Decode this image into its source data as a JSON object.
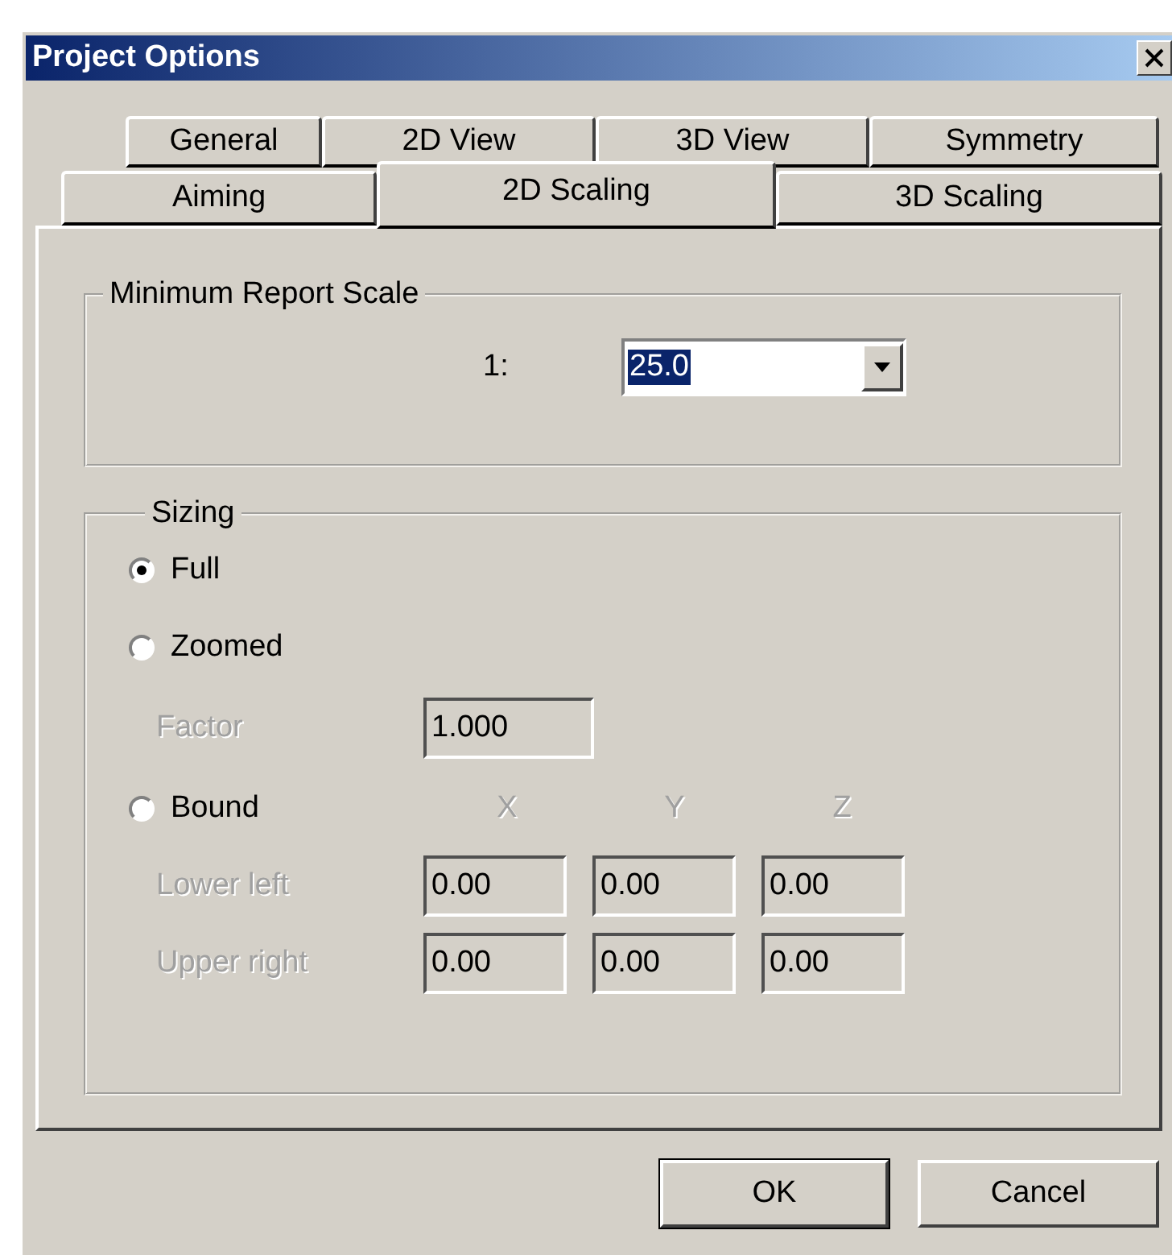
{
  "window": {
    "title": "Project Options"
  },
  "tab_rows": [
    {
      "tabs": [
        {
          "label": "General",
          "selected": false
        },
        {
          "label": "2D View",
          "selected": false
        },
        {
          "label": "3D View",
          "selected": false
        },
        {
          "label": "Symmetry",
          "selected": false
        }
      ]
    },
    {
      "tabs": [
        {
          "label": "Aiming",
          "selected": false
        },
        {
          "label": "2D Scaling",
          "selected": true
        },
        {
          "label": "3D Scaling",
          "selected": false
        }
      ]
    }
  ],
  "scale_group": {
    "title": "Minimum Report Scale",
    "label": "1:",
    "value": "25.0",
    "highlighted": true
  },
  "sizing": {
    "title": "Sizing",
    "options": [
      {
        "label": "Full",
        "selected": true
      },
      {
        "label": "Zoomed",
        "selected": false
      },
      {
        "label": "Bound",
        "selected": false
      }
    ],
    "factor": {
      "label": "Factor",
      "value": "1.000",
      "disabled": true
    },
    "bound": {
      "disabled": true,
      "columns": [
        "X",
        "Y",
        "Z"
      ],
      "rows": [
        {
          "label": "Lower left",
          "values": [
            "0.00",
            "0.00",
            "0.00"
          ]
        },
        {
          "label": "Upper right",
          "values": [
            "0.00",
            "0.00",
            "0.00"
          ]
        }
      ]
    }
  },
  "buttons": [
    {
      "label": "OK",
      "default": true
    },
    {
      "label": "Cancel",
      "default": false
    }
  ]
}
